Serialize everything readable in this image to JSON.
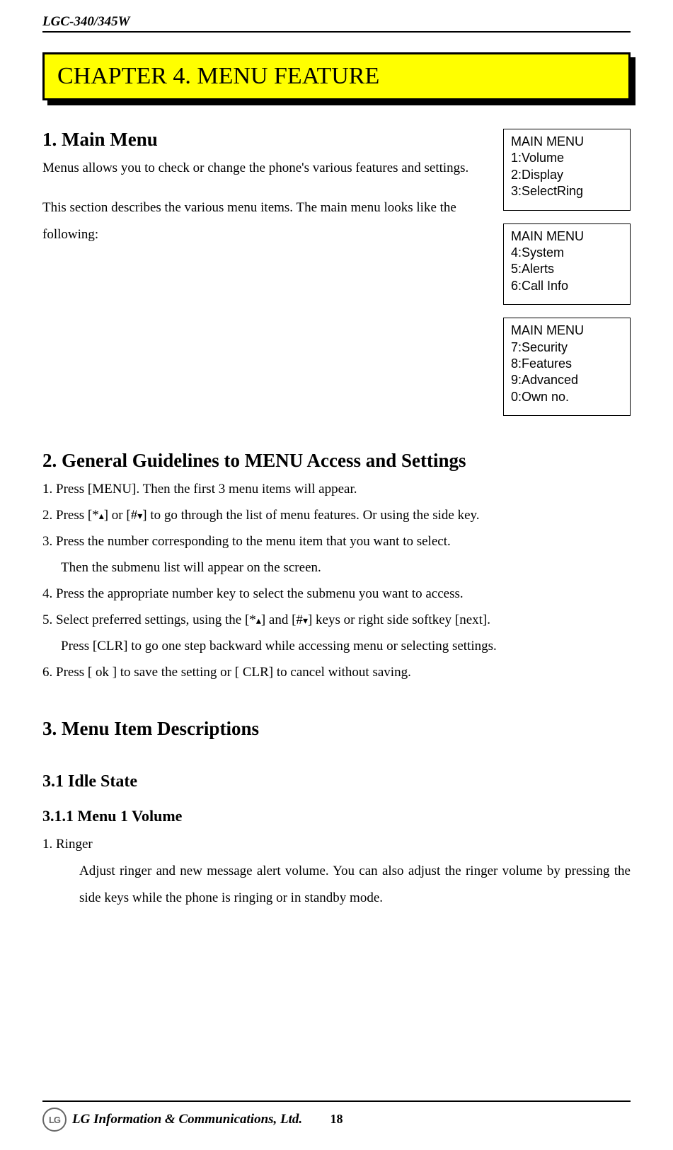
{
  "header": {
    "model": "LGC-340/345W"
  },
  "chapter": {
    "title": "CHAPTER 4. MENU FEATURE"
  },
  "s1": {
    "heading": "1. Main Menu",
    "p1a": "Menus allows you to check or change the phone's various features and settings.",
    "p2": "This section describes the various menu items. The main menu looks like the following:"
  },
  "menus": {
    "box1": {
      "title": "MAIN MENU",
      "l1": "1:Volume",
      "l2": "2:Display",
      "l3": "3:SelectRing"
    },
    "box2": {
      "title": "MAIN MENU",
      "l1": "4:System",
      "l2": "5:Alerts",
      "l3": "6:Call Info"
    },
    "box3": {
      "title": "MAIN MENU",
      "l1": "7:Security",
      "l2": "8:Features",
      "l3": "9:Advanced",
      "l4": "0:Own no."
    }
  },
  "s2": {
    "heading": "2. General Guidelines to MENU Access and Settings",
    "step1": "1. Press [MENU]. Then the first 3 menu items will appear.",
    "step2a": "2. Press [*",
    "step2b": "] or [#",
    "step2c": "] to go through the list of menu features. Or using the side key.",
    "step3": "3. Press the number corresponding to the menu item that you want to select.",
    "step3b": "Then the submenu list will appear on the screen.",
    "step4": "4. Press the appropriate number key to select the submenu you want to access.",
    "step5a": "5. Select preferred settings, using the [*",
    "step5b": "] and [#",
    "step5c": "] keys or right side softkey [next].",
    "step5d": "Press [CLR] to go one step backward while accessing menu or selecting settings.",
    "step6": "6. Press [ ok ] to save the setting or [ CLR] to cancel without saving."
  },
  "s3": {
    "heading": "3. Menu Item Descriptions",
    "sub1": "3.1 Idle State",
    "sub11": "3.1.1 Menu 1 Volume",
    "ringer_label": "1. Ringer",
    "ringer_body": "Adjust ringer and new message alert volume. You can also adjust the ringer volume by pressing the side keys while the phone is ringing or in standby mode."
  },
  "footer": {
    "logo_text": "LG",
    "company": "LG Information & Communications, Ltd.",
    "page": "18"
  }
}
